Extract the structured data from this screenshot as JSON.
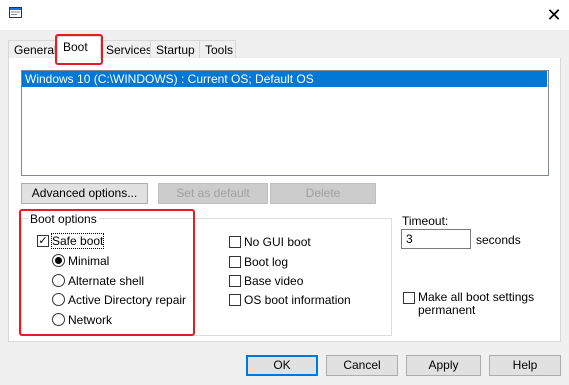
{
  "window": {
    "close_icon": "close-icon"
  },
  "tabs": [
    {
      "label": "General"
    },
    {
      "label": "Boot"
    },
    {
      "label": "Services"
    },
    {
      "label": "Startup"
    },
    {
      "label": "Tools"
    }
  ],
  "os_list": {
    "items": [
      "Windows 10 (C:\\WINDOWS) : Current OS; Default OS"
    ]
  },
  "buttons": {
    "advanced_options": "Advanced options...",
    "set_as_default": "Set as default",
    "delete": "Delete",
    "ok": "OK",
    "cancel": "Cancel",
    "apply": "Apply",
    "help": "Help"
  },
  "boot_options": {
    "legend": "Boot options",
    "safe_boot": "Safe boot",
    "safe_boot_checked": true,
    "radios": [
      {
        "label": "Minimal",
        "selected": true
      },
      {
        "label": "Alternate shell",
        "selected": false
      },
      {
        "label": "Active Directory repair",
        "selected": false
      },
      {
        "label": "Network",
        "selected": false
      }
    ],
    "checkboxes": [
      {
        "label": "No GUI boot",
        "checked": false
      },
      {
        "label": "Boot log",
        "checked": false
      },
      {
        "label": "Base video",
        "checked": false
      },
      {
        "label": "OS boot information",
        "checked": false
      }
    ]
  },
  "timeout": {
    "label": "Timeout:",
    "value": "3",
    "unit": "seconds"
  },
  "make_permanent": {
    "line1": "Make all boot settings",
    "line2": "permanent",
    "checked": false
  },
  "colors": {
    "selection": "#0078d7",
    "highlight_annotation": "#e02020"
  }
}
